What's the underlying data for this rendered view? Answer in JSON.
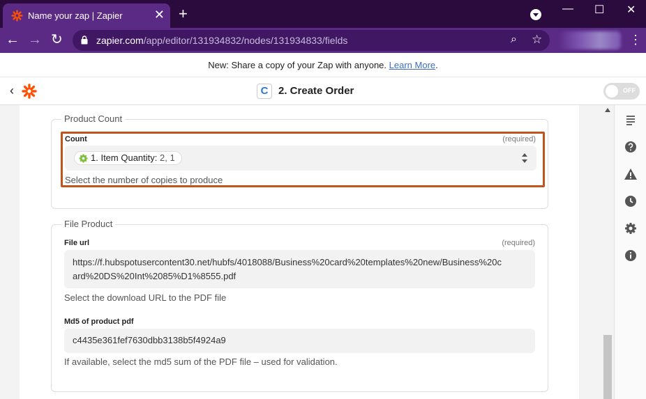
{
  "browser": {
    "tab_title": "Name your zap | Zapier",
    "tab_close": "✕",
    "new_tab": "+",
    "url_host": "zapier.com",
    "url_path": "/app/editor/131934832/nodes/131934833/fields",
    "icons": [
      "back-arrow-icon",
      "forward-arrow-icon",
      "reload-icon",
      "lock-icon",
      "zoom-icon",
      "star-icon",
      "menu-dots-icon"
    ]
  },
  "window_controls": {
    "minimize": "—",
    "maximize": "☐",
    "close": "✕"
  },
  "announcement": {
    "text": "New: Share a copy of your Zap with anyone.",
    "link": "Learn More",
    "suffix": "."
  },
  "appbar": {
    "back": "‹",
    "step_icon_letter": "C",
    "step_title": "2. Create Order",
    "toggle_label": "OFF"
  },
  "sections": {
    "product_count": {
      "legend": "Product Count",
      "count_label": "Count",
      "count_required": "(required)",
      "pill_name": "1. Item Quantity:",
      "pill_values": "2, 1",
      "count_help": "Select the number of copies to produce"
    },
    "file_product": {
      "legend": "File Product",
      "file_url_label": "File url",
      "file_url_required": "(required)",
      "file_url_line1": "https://f.hubspotusercontent30.net/hubfs/4018088/Business%20card%20templates%20new/Business%20c",
      "file_url_line2": "ard%20DS%20Int%2085%D1%8555.pdf",
      "file_url_help": "Select the download URL to the PDF file",
      "md5_label": "Md5 of product pdf",
      "md5_value": "c4435e361fef7630dbb3138b5f4924a9",
      "md5_help": "If available, select the md5 sum of the PDF file – used for validation."
    }
  },
  "sidebar_icons": [
    "details-icon",
    "help-icon",
    "alert-icon",
    "history-icon",
    "settings-icon",
    "info-icon"
  ],
  "colors": {
    "chrome_dark": "#2b0a3d",
    "chrome_toolbar": "#5a2a85",
    "zapier_orange": "#ff4f00",
    "highlight_border": "#c0541a",
    "link": "#3d6dbf"
  }
}
